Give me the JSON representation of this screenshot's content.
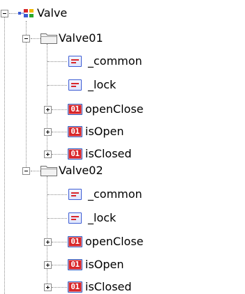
{
  "tree": {
    "root": {
      "label": "Valve",
      "icon": "struct-type-icon",
      "expanded": true,
      "children": [
        {
          "label": "Valve01",
          "icon": "folder-icon",
          "expanded": true,
          "children": [
            {
              "label": "_common",
              "icon": "element-icon",
              "expandable": false
            },
            {
              "label": "_lock",
              "icon": "element-icon",
              "expandable": false
            },
            {
              "label": "openClose",
              "icon": "bit-icon",
              "icon_text": "01",
              "expandable": true
            },
            {
              "label": "isOpen",
              "icon": "bit-icon",
              "icon_text": "01",
              "expandable": true
            },
            {
              "label": "isClosed",
              "icon": "bit-icon",
              "icon_text": "01",
              "expandable": true
            }
          ]
        },
        {
          "label": "Valve02",
          "icon": "folder-icon",
          "expanded": true,
          "children": [
            {
              "label": "_common",
              "icon": "element-icon",
              "expandable": false
            },
            {
              "label": "_lock",
              "icon": "element-icon",
              "expandable": false
            },
            {
              "label": "openClose",
              "icon": "bit-icon",
              "icon_text": "01",
              "expandable": true
            },
            {
              "label": "isOpen",
              "icon": "bit-icon",
              "icon_text": "01",
              "expandable": true
            },
            {
              "label": "isClosed",
              "icon": "bit-icon",
              "icon_text": "01",
              "expandable": true
            }
          ]
        }
      ]
    }
  },
  "colors": {
    "tree_line": "#8c8c8c",
    "bit_icon_fill": "#d8262a",
    "element_icon_border": "#3b5bd3",
    "folder_fill": "#e8e8e8"
  }
}
